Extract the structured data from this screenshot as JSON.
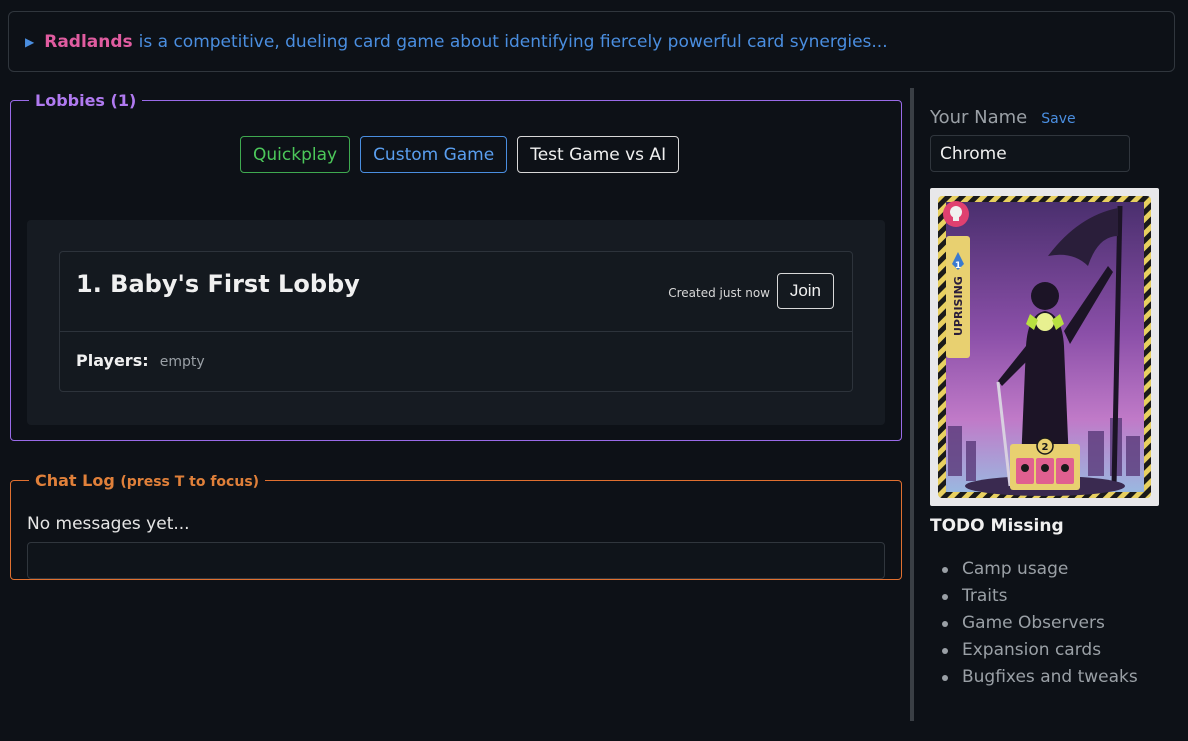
{
  "intro": {
    "brand": "Radlands",
    "text": "is a competitive, dueling card game about identifying fiercely powerful card synergies..."
  },
  "lobbies": {
    "legend": "Lobbies (1)",
    "buttons": {
      "quickplay": "Quickplay",
      "custom": "Custom Game",
      "ai": "Test Game vs AI"
    },
    "items": [
      {
        "title": "1. Baby's First Lobby",
        "created": "Created just now",
        "join": "Join",
        "players_label": "Players:",
        "players_value": "empty"
      }
    ]
  },
  "chat": {
    "legend": "Chat Log",
    "hint": "(press T to focus)",
    "empty": "No messages yet..."
  },
  "sidebar": {
    "name_label": "Your Name",
    "save_label": "Save",
    "name_value": "Chrome",
    "card_label": "UPRISING",
    "card_cost": "1",
    "card_ability_cost": "2",
    "todo_title": "TODO Missing",
    "todo": [
      "Camp usage",
      "Traits",
      "Game Observers",
      "Expansion cards",
      "Bugfixes and tweaks"
    ]
  },
  "colors": {
    "background": "#0d1117",
    "brand": "#e05ca0",
    "link": "#4a8ee0",
    "lobbies_border": "#9a6be8",
    "chat_border": "#e07030",
    "quickplay": "#4cc85a"
  }
}
